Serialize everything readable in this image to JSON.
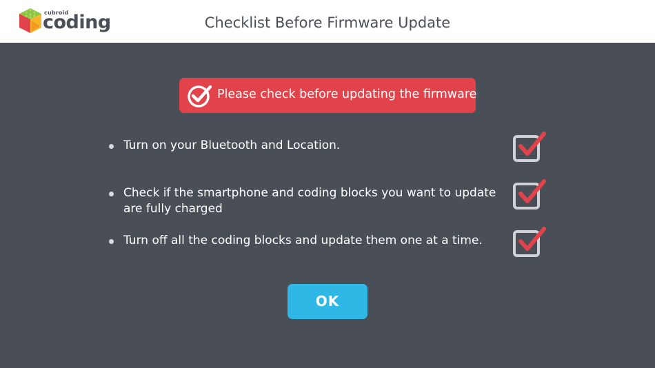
{
  "header": {
    "logo_small": "cubroid",
    "logo_text": "coding",
    "title": "Checklist Before Firmware Update"
  },
  "banner": {
    "text": "Please check before updating the firmware",
    "icon": "check-circle-icon",
    "color": "#e2434b"
  },
  "checklist": [
    {
      "text": "Turn on your Bluetooth and Location.",
      "checked": true
    },
    {
      "text": "Check if the smartphone and coding blocks you want to update are fully charged",
      "checked": true
    },
    {
      "text": "Turn off all the coding blocks and update them one at a time.",
      "checked": true
    }
  ],
  "ok_button": {
    "label": "OK",
    "color": "#2fb8e6"
  },
  "colors": {
    "background": "#4a4e57",
    "header_bg": "#ffffff",
    "check_mark": "#e2434b"
  }
}
